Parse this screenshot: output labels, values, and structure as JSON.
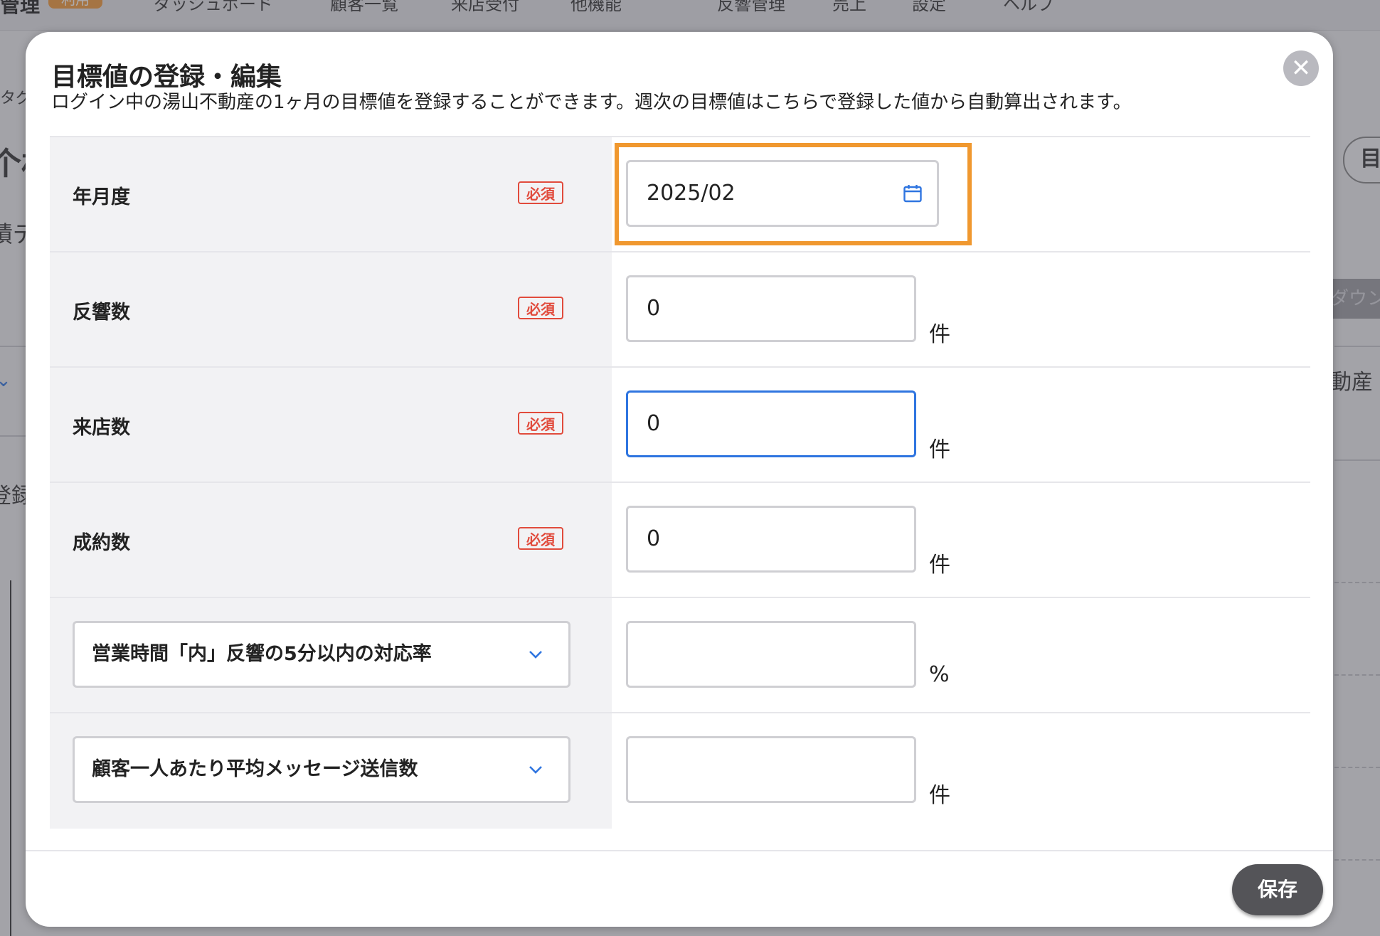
{
  "background": {
    "nav": {
      "brand": "管理",
      "badge": "利用",
      "items": [
        "ダッシュボード",
        "顧客一覧",
        "来店受付",
        "他機能",
        "反響管理",
        "売上",
        "設定",
        "ヘルプ"
      ]
    },
    "fragments": {
      "tag": "タグ",
      "heading_char": "个材",
      "data_label": "績デ",
      "register": "登録",
      "right_pill": "目",
      "right_button": "ダウン",
      "right_text": "動産"
    }
  },
  "modal": {
    "title": "目標値の登録・編集",
    "description": "ログイン中の湯山不動産の1ヶ月の目標値を登録することができます。週次の目標値はこちらで登録した値から自動算出されます。",
    "close_icon": "close-icon",
    "rows": [
      {
        "label": "年月度",
        "required": "必須",
        "value": "2025/02",
        "icon": "calendar-icon"
      },
      {
        "label": "反響数",
        "required": "必須",
        "value": "0",
        "unit": "件"
      },
      {
        "label": "来店数",
        "required": "必須",
        "value": "0",
        "unit": "件"
      },
      {
        "label": "成約数",
        "required": "必須",
        "value": "0",
        "unit": "件"
      },
      {
        "select": "営業時間「内」反響の5分以内の対応率",
        "value": "",
        "unit": "%"
      },
      {
        "select": "顧客一人あたり平均メッセージ送信数",
        "value": "",
        "unit": "件"
      }
    ],
    "save_label": "保存"
  },
  "colors": {
    "highlight": "#f0982f",
    "required": "#e14b3c",
    "focus": "#2f75e0",
    "accent_icon": "#2f75e0",
    "save_button": "#545458"
  }
}
